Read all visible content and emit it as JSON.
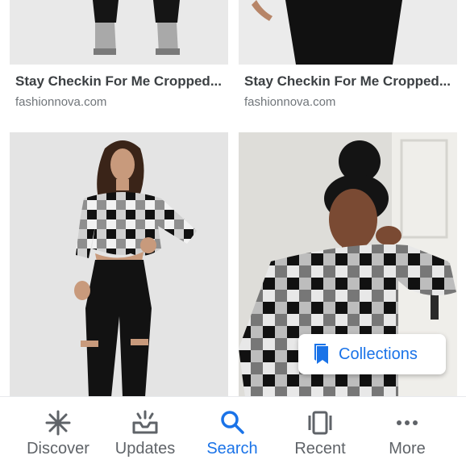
{
  "results": [
    {
      "title": "Stay Checkin For Me Cropped...",
      "source": "fashionnova.com"
    },
    {
      "title": "Stay Checkin For Me Cropped...",
      "source": "fashionnova.com"
    },
    {
      "title": "",
      "source": ""
    },
    {
      "title": "",
      "source": ""
    }
  ],
  "chip": {
    "label": "Collections",
    "icon": "bookmarks-icon"
  },
  "nav": {
    "items": [
      {
        "label": "Discover",
        "icon": "asterisk-icon"
      },
      {
        "label": "Updates",
        "icon": "updates-tray-icon"
      },
      {
        "label": "Search",
        "icon": "search-icon"
      },
      {
        "label": "Recent",
        "icon": "recent-cards-icon"
      },
      {
        "label": "More",
        "icon": "more-dots-icon"
      }
    ],
    "active_index": 2
  },
  "colors": {
    "accent": "#1a73e8",
    "inactive": "#5f6368",
    "title": "#3c4043",
    "source": "#70757a"
  }
}
